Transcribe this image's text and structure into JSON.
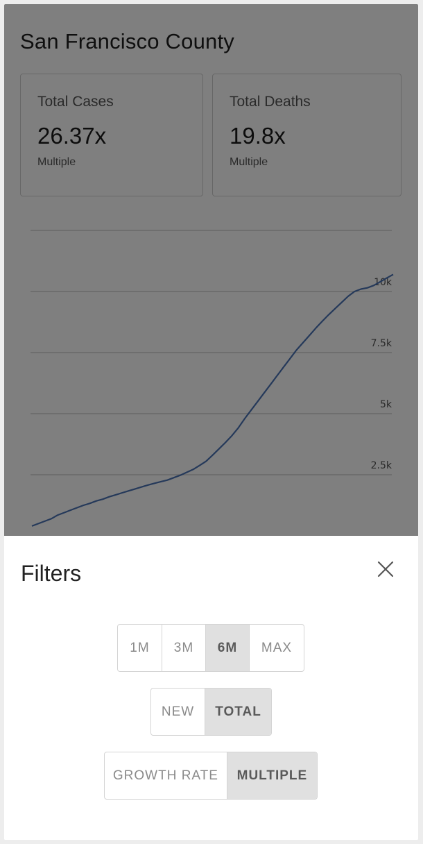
{
  "header": {
    "title": "San Francisco County"
  },
  "cards": {
    "cases": {
      "label": "Total Cases",
      "value": "26.37x",
      "sub": "Multiple"
    },
    "deaths": {
      "label": "Total Deaths",
      "value": "19.8x",
      "sub": "Multiple"
    }
  },
  "chart_data": {
    "type": "line",
    "y_tick_labels": [
      "10k",
      "7.5k",
      "5k",
      "2.5k"
    ],
    "ylim": [
      0,
      12500
    ],
    "grid": true,
    "color": "#4a73b5",
    "series": [
      {
        "values": [
          400,
          500,
          600,
          700,
          850,
          950,
          1050,
          1150,
          1250,
          1330,
          1430,
          1500,
          1600,
          1680,
          1760,
          1840,
          1920,
          2000,
          2080,
          2150,
          2220,
          2280,
          2380,
          2480,
          2600,
          2720,
          2880,
          3050,
          3300,
          3560,
          3820,
          4100,
          4420,
          4800,
          5150,
          5500,
          5850,
          6200,
          6550,
          6900,
          7250,
          7600,
          7900,
          8200,
          8500,
          8780,
          9050,
          9300,
          9550,
          9800,
          10000,
          10100,
          10150,
          10250,
          10400,
          10550,
          10700
        ]
      }
    ]
  },
  "sheet": {
    "title": "Filters",
    "close_icon": "close-icon",
    "range_options": [
      "1M",
      "3M",
      "6M",
      "MAX"
    ],
    "range_selected": "6M",
    "mode_options": [
      "NEW",
      "TOTAL"
    ],
    "mode_selected": "TOTAL",
    "metric_options": [
      "GROWTH RATE",
      "MULTIPLE"
    ],
    "metric_selected": "MULTIPLE"
  },
  "colors": {
    "accent_line": "#4a73b5",
    "overlay": "rgba(0,0,0,0.5)",
    "selected_bg": "#e0e0e0"
  }
}
